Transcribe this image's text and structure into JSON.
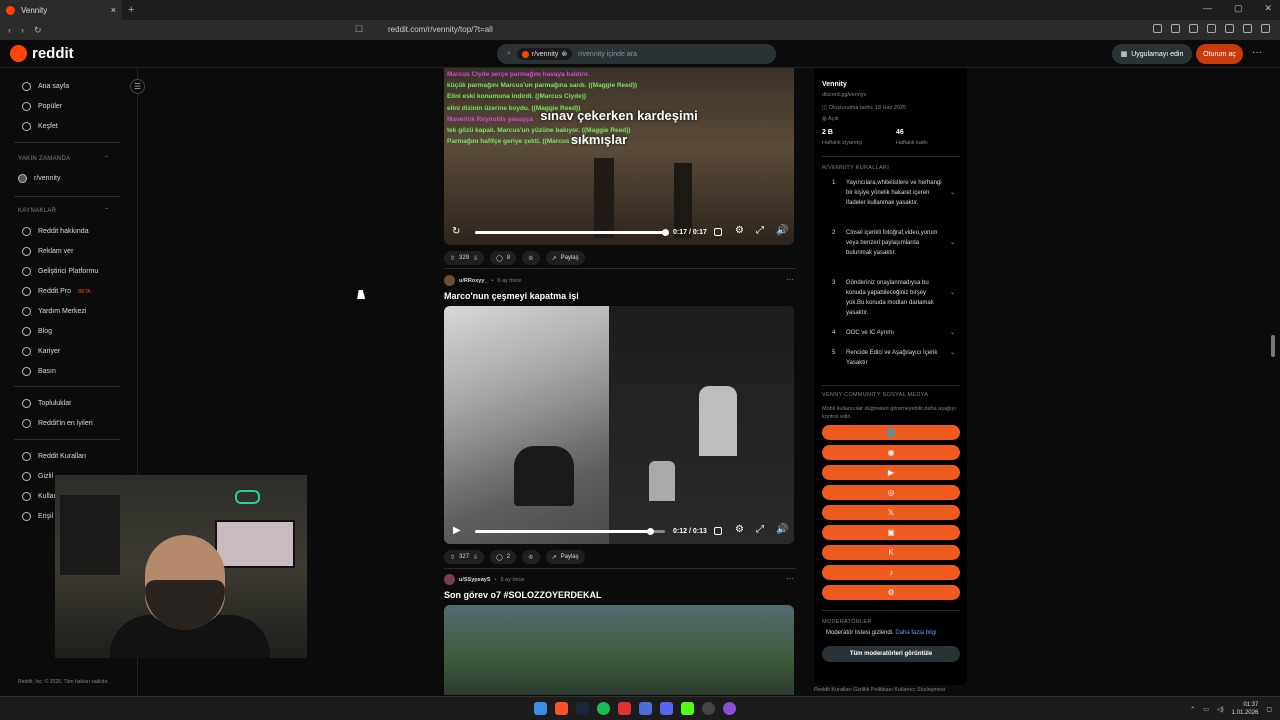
{
  "browser": {
    "tab_title": "Vennity",
    "tab_close": "×",
    "new_tab": "+",
    "url": "reddit.com/r/vennity/top/?t=all",
    "win_controls": [
      "—",
      "▢",
      "✕"
    ]
  },
  "header": {
    "logo_text": "reddit",
    "search_chip": "r/vennity",
    "search_placeholder": "r/vennity içinde ara",
    "app_button": "Uygulamayı edin",
    "login_button": "Oturum aç",
    "more": "···"
  },
  "sidebar": {
    "top_items": [
      "Ana sayfa",
      "Popüler",
      "Keşfet"
    ],
    "recent_heading": "YAKIN ZAMANDA",
    "recent_items": [
      "r/vennity"
    ],
    "resources_heading": "KAYNAKLAR",
    "resource_items": [
      "Reddit hakkında",
      "Reklam ver",
      "Geliştirici Platformu",
      "Reddit Pro",
      "Yardım Merkezi",
      "Blog",
      "Kariyer",
      "Basın"
    ],
    "pro_badge": "BETA",
    "community_items": [
      "Topluluklar",
      "Reddit'in en iyileri"
    ],
    "policy_items": [
      "Reddit Kuralları",
      "Gizlil",
      "Kullan",
      "Erişil"
    ],
    "footer": "Reddit, Inc. © 2025. Tüm hakları saklıdır.",
    "collapse_icon": "☰"
  },
  "posts": [
    {
      "subtitles": [
        {
          "text": "Marcus Clyde serçe parmağını havaya kaldırır.",
          "color": "#d64ad6"
        },
        {
          "text": "küçük parmağını Marcus'un parmağına sardı. ((Maggie Reed))",
          "color": "#7ee35c"
        },
        {
          "text": "Elini eski konumuna indirdi. ((Marcus Clyde))",
          "color": "#7ee35c"
        },
        {
          "text": "elini dizinin üzerine koydu. ((Maggie Reed))",
          "color": "#7ee35c"
        },
        {
          "text": "Maverick Reynolds yavaşça",
          "color": "#d64ad6"
        },
        {
          "text": "tek gözü kapalı. Marcus'un yüzüne bakıyor. ((Maggie Reed))",
          "color": "#7ee35c"
        },
        {
          "text": "Parmağını hafifçe geriye çekti. ((Marcus Clyde))",
          "color": "#7ee35c"
        }
      ],
      "caption_line1": "sınav çekerken kardeşimi",
      "caption_line2": "sıkmışlar",
      "time": "0:17 / 0:17",
      "progress": 1.0,
      "votes": "329",
      "comments": "8",
      "share": "Paylaş"
    },
    {
      "author": "u/RRoxyy_",
      "age": "6 ay önce",
      "title": "Marco'nun çeşmeyi kapatma işi",
      "time": "0:12 / 0:13",
      "progress": 0.92,
      "votes": "327",
      "comments": "2",
      "share": "Paylaş"
    },
    {
      "author": "u/SSypsayS",
      "age": "5 ay önce",
      "title": "Son görev o7 #SOLOZZOYERDEKAL"
    }
  ],
  "right_panel": {
    "name": "Vennity",
    "link": "discord.gg/vennyv",
    "created": "Oluşturulma tarihi: 18 Haz 2025",
    "visibility": "Açık",
    "stat1_value": "2 B",
    "stat1_label": "Haftalık ziyaretçi",
    "stat2_value": "46",
    "stat2_label": "Haftalık katkı",
    "rules_heading": "R/VENNITY KURALLARI",
    "rules": [
      {
        "n": "1",
        "text": "Yayıncılara,whitelistlere ve herhangi bir kişiye yönelik hakaret içeren ifadeler kullanmak yasaktır."
      },
      {
        "n": "2",
        "text": "Cinsel içerikli fotoğraf,video,yorum veya benzeri paylaşımlarda bulunmak yasaktır."
      },
      {
        "n": "3",
        "text": "Gönderiniz onaylanmadıysa bu konuda yapabileceğiniz birşey yok.Bu konuda modları darlamak yasaktır."
      },
      {
        "n": "4",
        "text": "OOC ve IC Ayrımı"
      },
      {
        "n": "5",
        "text": "Rencide Edici ve Aşağılayıcı İçerik Yasaktır"
      }
    ],
    "social_heading": "VENNY COMMUNITY SOSYAL MEDYA",
    "social_desc": "Mobil kullanıcılar düğmeleri göremeyebilir,daha aşağıyı kontrol edin.",
    "social_icons": [
      "globe-icon",
      "discord-icon",
      "youtube-icon",
      "instagram-icon",
      "x-icon",
      "twitch-icon",
      "kick-icon",
      "tiktok-icon",
      "steam-icon"
    ],
    "social_glyphs": [
      "🌐",
      "◉",
      "▶",
      "◎",
      "𝕏",
      "▣",
      "K",
      "♪",
      "⚙"
    ],
    "mods_heading": "MODERATÖRLER",
    "mods_hidden": "Moderatör listesi gizlendi.",
    "mods_more": "Daha fazla bilgi",
    "mods_button": "Tüm moderatörleri görüntüle",
    "footer": "Reddit Kuralları   Gizlilik Politikası   Kullanıcı Sözleşmesi"
  },
  "taskbar": {
    "time": "01:37",
    "date": "1.01.2026"
  }
}
